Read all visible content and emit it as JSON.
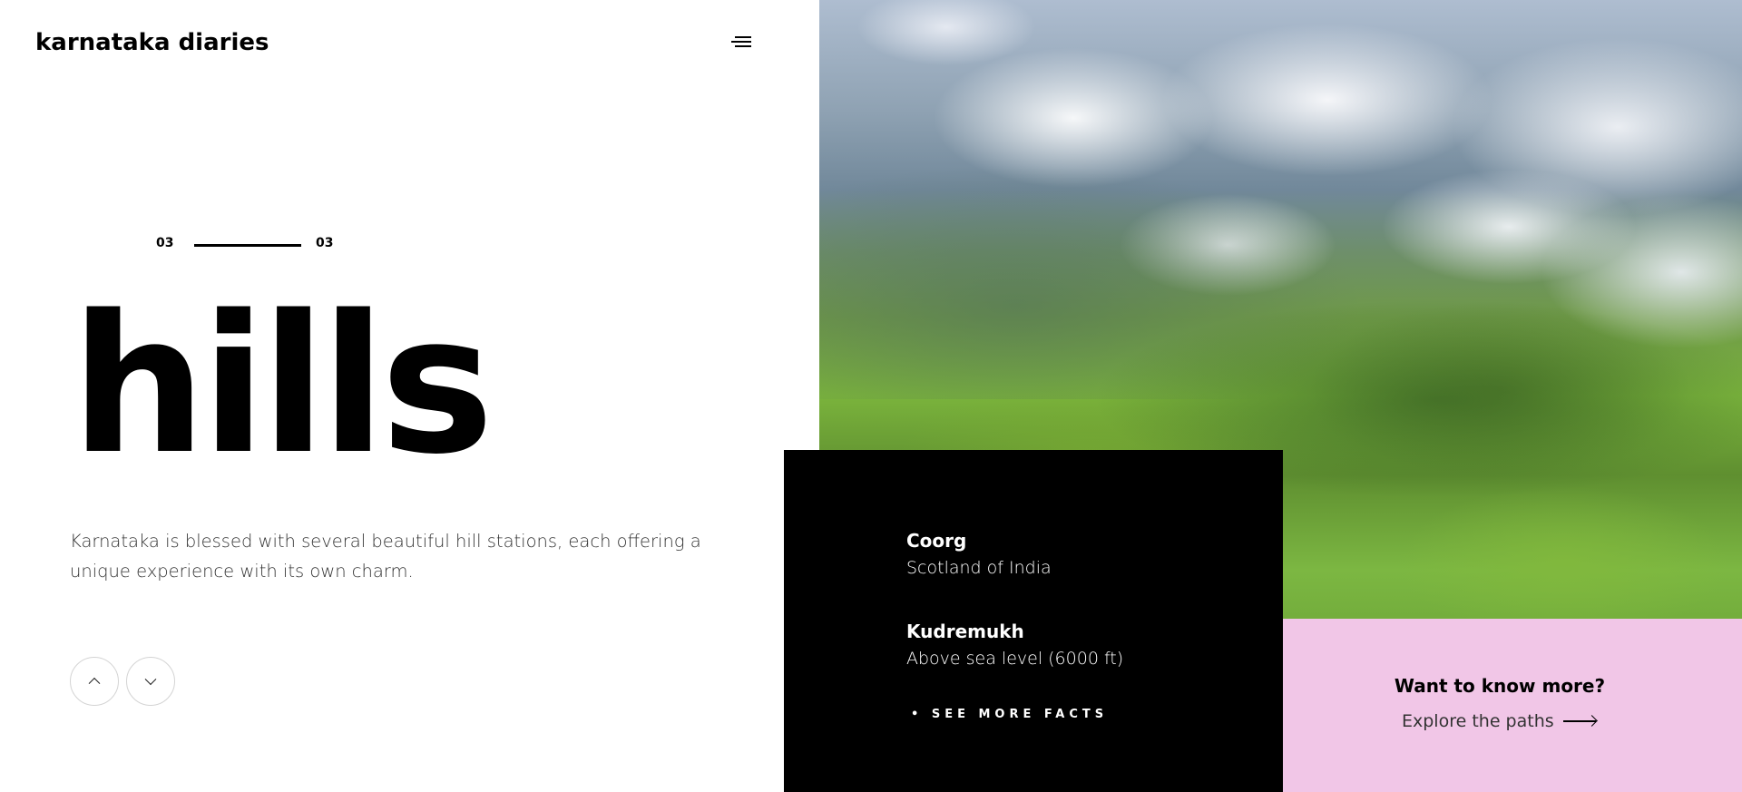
{
  "header": {
    "brand": "karnataka diaries",
    "menu_icon": "menu-icon"
  },
  "slider": {
    "current": "03",
    "total": "03",
    "progress": 1.0
  },
  "main": {
    "headline": "hills",
    "description": "Karnataka is blessed with several beautiful hill stations, each offering a unique experience with its own charm.",
    "nav": {
      "prev_icon": "chevron-up-icon",
      "next_icon": "chevron-down-icon"
    }
  },
  "hero_image": {
    "subject": "green hills with clouds"
  },
  "facts": {
    "items": [
      {
        "title": "Coorg",
        "subtitle": "Scotland of India"
      },
      {
        "title": "Kudremukh",
        "subtitle": "Above sea level (6000 ft)"
      }
    ],
    "see_more_label": "• SEE MORE FACTS"
  },
  "cta": {
    "question": "Want to know more?",
    "link_label": "Explore the paths",
    "arrow_icon": "arrow-right-icon"
  },
  "colors": {
    "cta_background": "#f1c6e7",
    "facts_background": "#000000"
  }
}
